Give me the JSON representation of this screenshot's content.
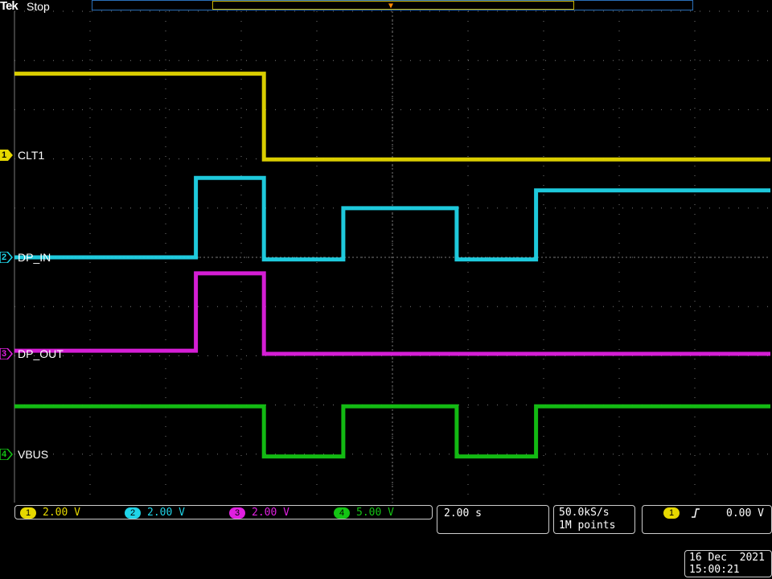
{
  "header": {
    "brand": "Tek",
    "acq_state": "Stop"
  },
  "colors": {
    "ch1": "#e6d800",
    "ch2": "#20d4e8",
    "ch3": "#e020e0",
    "ch4": "#14c414",
    "grid": "#7a7a7a",
    "trigger_marker": "#ff8a00"
  },
  "channels": [
    {
      "num": "1",
      "label": "CLT1"
    },
    {
      "num": "2",
      "label": "DP_IN"
    },
    {
      "num": "3",
      "label": "DP_OUT"
    },
    {
      "num": "4",
      "label": "VBUS"
    }
  ],
  "scales": [
    {
      "num": "1",
      "value": "2.00 V"
    },
    {
      "num": "2",
      "value": "2.00 V"
    },
    {
      "num": "3",
      "value": "2.00 V"
    },
    {
      "num": "4",
      "value": "5.00 V"
    }
  ],
  "timebase": {
    "scale": "2.00 s"
  },
  "acquisition": {
    "rate": "50.0kS/s",
    "record": "1M points"
  },
  "trigger": {
    "source": "1",
    "slope": "rising-edge-icon",
    "level": "0.00 V"
  },
  "datetime": {
    "date": "16 Dec  2021",
    "time": "15:00:21"
  },
  "chart_data": {
    "type": "line",
    "xlabel": "",
    "ylabel": "",
    "x_unit": "divisions (2.00 s/div), 0 = left edge",
    "xlim": [
      0,
      10
    ],
    "grid": true,
    "series": [
      {
        "name": "CLT1",
        "channel": 1,
        "values_unit": "divisions above channel marker",
        "points": [
          [
            0,
            0.78
          ],
          [
            3.3,
            0.78
          ],
          [
            3.3,
            -0.04
          ],
          [
            10,
            -0.04
          ]
        ]
      },
      {
        "name": "DP_IN",
        "channel": 2,
        "values_unit": "divisions above channel marker",
        "points": [
          [
            0,
            0.0
          ],
          [
            2.4,
            0.0
          ],
          [
            2.4,
            0.76
          ],
          [
            3.3,
            0.76
          ],
          [
            3.3,
            -0.02
          ],
          [
            4.35,
            -0.02
          ],
          [
            4.35,
            0.47
          ],
          [
            5.85,
            0.47
          ],
          [
            5.85,
            -0.02
          ],
          [
            6.9,
            -0.02
          ],
          [
            6.9,
            0.64
          ],
          [
            10,
            0.64
          ]
        ]
      },
      {
        "name": "DP_OUT",
        "channel": 3,
        "values_unit": "divisions above channel marker",
        "points": [
          [
            0,
            0.03
          ],
          [
            2.4,
            0.03
          ],
          [
            2.4,
            0.77
          ],
          [
            3.3,
            0.77
          ],
          [
            3.3,
            0.0
          ],
          [
            10,
            0.0
          ]
        ]
      },
      {
        "name": "VBUS",
        "channel": 4,
        "values_unit": "divisions above channel marker",
        "points": [
          [
            0,
            0.46
          ],
          [
            3.3,
            0.46
          ],
          [
            3.3,
            -0.02
          ],
          [
            4.35,
            -0.02
          ],
          [
            4.35,
            0.46
          ],
          [
            5.85,
            0.46
          ],
          [
            5.85,
            -0.02
          ],
          [
            6.9,
            -0.02
          ],
          [
            6.9,
            0.46
          ],
          [
            10,
            0.46
          ]
        ]
      }
    ]
  }
}
